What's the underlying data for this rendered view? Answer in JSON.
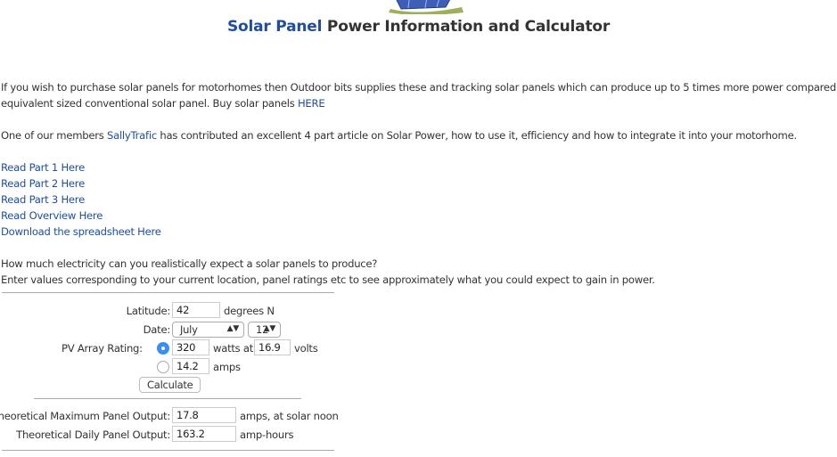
{
  "title": {
    "highlight": "Solar Panel",
    "rest": " Power Information and Calculator"
  },
  "intro": {
    "text": "If you wish to purchase solar panels for motorhomes then Outdoor bits supplies these and tracking solar panels which can produce up to 5 times more power compared to an",
    "text2": "equivalent sized conventional solar panel. Buy solar panels ",
    "link": "HERE"
  },
  "members": {
    "prefix": "One of our members ",
    "user": "SallyTrafic",
    "suffix": " has contributed an excellent 4 part article on Solar Power, how to use it, efficiency and how to integrate it into your motorhome."
  },
  "links": [
    "Read Part 1 Here",
    "Read Part 2 Here",
    "Read Part 3 Here",
    "Read Overview Here",
    "Download the spreadsheet Here"
  ],
  "question": "How much electricity can you realistically expect a solar panels to produce?",
  "instruction": "Enter values corresponding to your current location, panel ratings etc to see approximately what you could expect to gain in power.",
  "form": {
    "latitude_label": "Latitude:",
    "latitude": "42",
    "latitude_unit": "degrees N",
    "date_label": "Date:",
    "month": "July",
    "day": "12",
    "pv_label": "PV Array Rating:",
    "watts": "320",
    "watts_unit": "watts at",
    "volts": "16.9",
    "volts_unit": "volts",
    "amps": "14.2",
    "amps_unit": "amps",
    "calculate": "Calculate",
    "selected_option": "watts"
  },
  "results": {
    "max_label": "Theoretical Maximum Panel Output:",
    "max_value": "17.8",
    "max_unit": "amps, at solar noon",
    "daily_label": "Theoretical Daily Panel Output:",
    "daily_value": "163.2",
    "daily_unit": "amp-hours"
  },
  "colors": {
    "link": "#1f4e9c",
    "radio": "#3b8ef3"
  }
}
